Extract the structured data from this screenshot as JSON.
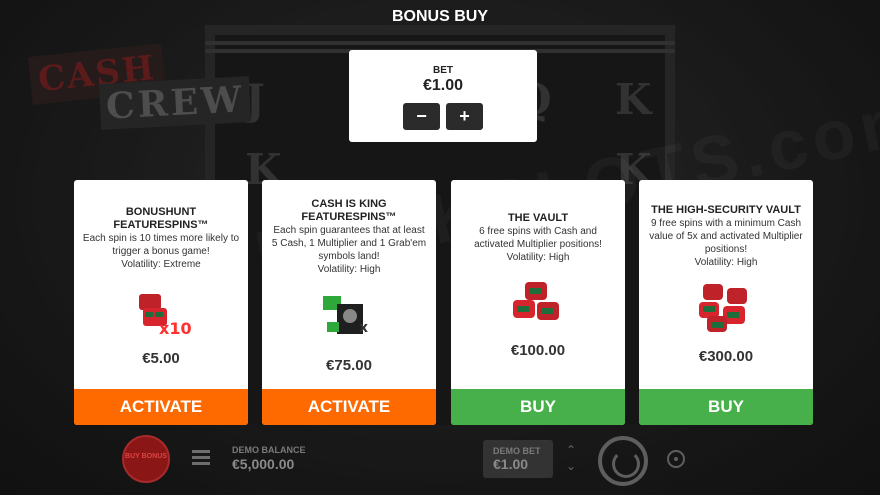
{
  "background": {
    "logo_line1": "CASH",
    "logo_line2": "CREW",
    "watermark": "VIPBOOKSLOTS.com",
    "symbols": [
      "J",
      "Q",
      "K",
      "K",
      "K"
    ]
  },
  "dialog": {
    "title": "BONUS BUY",
    "bet": {
      "label": "BET",
      "value": "€1.00",
      "minus_label": "−",
      "plus_label": "+"
    }
  },
  "cards": [
    {
      "title_line1": "BONUSHUNT",
      "title_line2": "FEATURESPINS™",
      "description": "Each spin is 10 times more likely to trigger a bonus game!",
      "volatility": "Volatility: Extreme",
      "icon": "cash-bags-x10-icon",
      "icon_text": "x10",
      "price": "€5.00",
      "action": "ACTIVATE",
      "action_color": "#ff6a00"
    },
    {
      "title_line1": "CASH IS KING",
      "title_line2": "FEATURESPINS™",
      "description": "Each spin guarantees that at least 5 Cash, 1 Multiplier and 1 Grab'em symbols land!",
      "volatility": "Volatility: High",
      "icon": "cash-is-king-icon",
      "icon_text": "x",
      "price": "€75.00",
      "action": "ACTIVATE",
      "action_color": "#ff6a00"
    },
    {
      "title_line1": "THE VAULT",
      "title_line2": "",
      "description": "6 free spins with Cash and activated Multiplier positions!",
      "volatility": "Volatility: High",
      "icon": "money-bags-icon",
      "icon_text": "",
      "price": "€100.00",
      "action": "BUY",
      "action_color": "#47b04b"
    },
    {
      "title_line1": "THE HIGH-SECURITY VAULT",
      "title_line2": "",
      "description": "9 free spins with a minimum Cash value of 5x and activated Multiplier positions!",
      "volatility": "Volatility: High",
      "icon": "money-bags-stack-icon",
      "icon_text": "",
      "price": "€300.00",
      "action": "BUY",
      "action_color": "#47b04b"
    }
  ],
  "footer": {
    "bonus_button_label": "BUY BONUS",
    "balance_label": "DEMO BALANCE",
    "balance_value": "€5,000.00",
    "bet_label": "DEMO BET",
    "bet_value": "€1.00"
  }
}
